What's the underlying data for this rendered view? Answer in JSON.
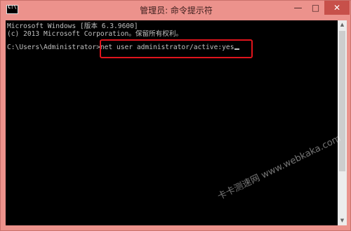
{
  "window": {
    "title": "管理员: 命令提示符",
    "controls": {
      "minimize": "—",
      "maximize": "□",
      "close": "✕"
    },
    "icon": "console-icon"
  },
  "console": {
    "line1": "Microsoft Windows [版本 6.3.9600]",
    "line2": "(c) 2013 Microsoft Corporation。保留所有权利。",
    "prompt": "C:\\Users\\Administrator>",
    "command": "net user administrator/active:yes"
  },
  "scrollbar": {
    "up": "▲",
    "down": "▼"
  },
  "watermark": "卡卡测速网 www.webkaka.com",
  "colors": {
    "titlebar": "#ec928c",
    "console_bg": "#000000",
    "console_text": "#c0c0c0",
    "highlight": "#e0141c"
  }
}
